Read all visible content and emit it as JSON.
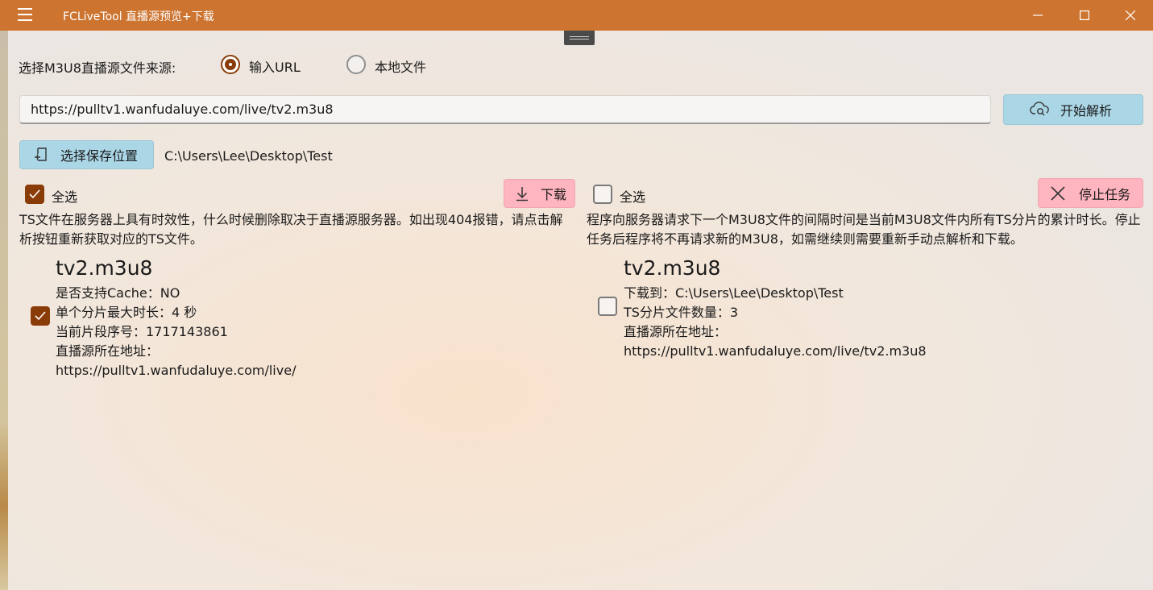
{
  "window": {
    "title": "FCLiveTool 直播源预览+下载",
    "titlebar_color": "#cd7430"
  },
  "source": {
    "label": "选择M3U8直播源文件来源:",
    "options": [
      {
        "label": "输入URL",
        "selected": true
      },
      {
        "label": "本地文件",
        "selected": false
      }
    ]
  },
  "url_input": {
    "value": "https://pulltv1.wanfudaluye.com/live/tv2.m3u8"
  },
  "parse_button": {
    "label": "开始解析",
    "icon": "cloud-search-icon"
  },
  "save": {
    "button_label": "选择保存位置",
    "icon": "folder-save-icon",
    "path": "C:\\Users\\Lee\\Desktop\\Test"
  },
  "left_panel": {
    "select_all_label": "全选",
    "select_all_checked": true,
    "download_button": "下载",
    "note": "TS文件在服务器上具有时效性，什么时候删除取决于直播源服务器。如出现404报错，请点击解析按钮重新获取对应的TS文件。",
    "item": {
      "checked": true,
      "name": "tv2.m3u8",
      "lines": [
        "是否支持Cache：NO",
        "单个分片最大时长：4 秒",
        "当前片段序号：1717143861",
        "直播源所在地址：",
        "https://pulltv1.wanfudaluye.com/live/"
      ]
    }
  },
  "right_panel": {
    "select_all_label": "全选",
    "select_all_checked": false,
    "stop_button": "停止任务",
    "note": "程序向服务器请求下一个M3U8文件的间隔时间是当前M3U8文件内所有TS分片的累计时长。停止任务后程序将不再请求新的M3U8，如需继续则需要重新手动点解析和下载。",
    "item": {
      "checked": false,
      "name": "tv2.m3u8",
      "lines": [
        "下载到：C:\\Users\\Lee\\Desktop\\Test",
        "TS分片文件数量：3",
        "直播源所在地址：",
        "https://pulltv1.wanfudaluye.com/live/tv2.m3u8"
      ]
    }
  },
  "colors": {
    "accent": "#8a3c08",
    "blue_button": "#aad6e6",
    "pink_button": "#ffb5c0"
  }
}
